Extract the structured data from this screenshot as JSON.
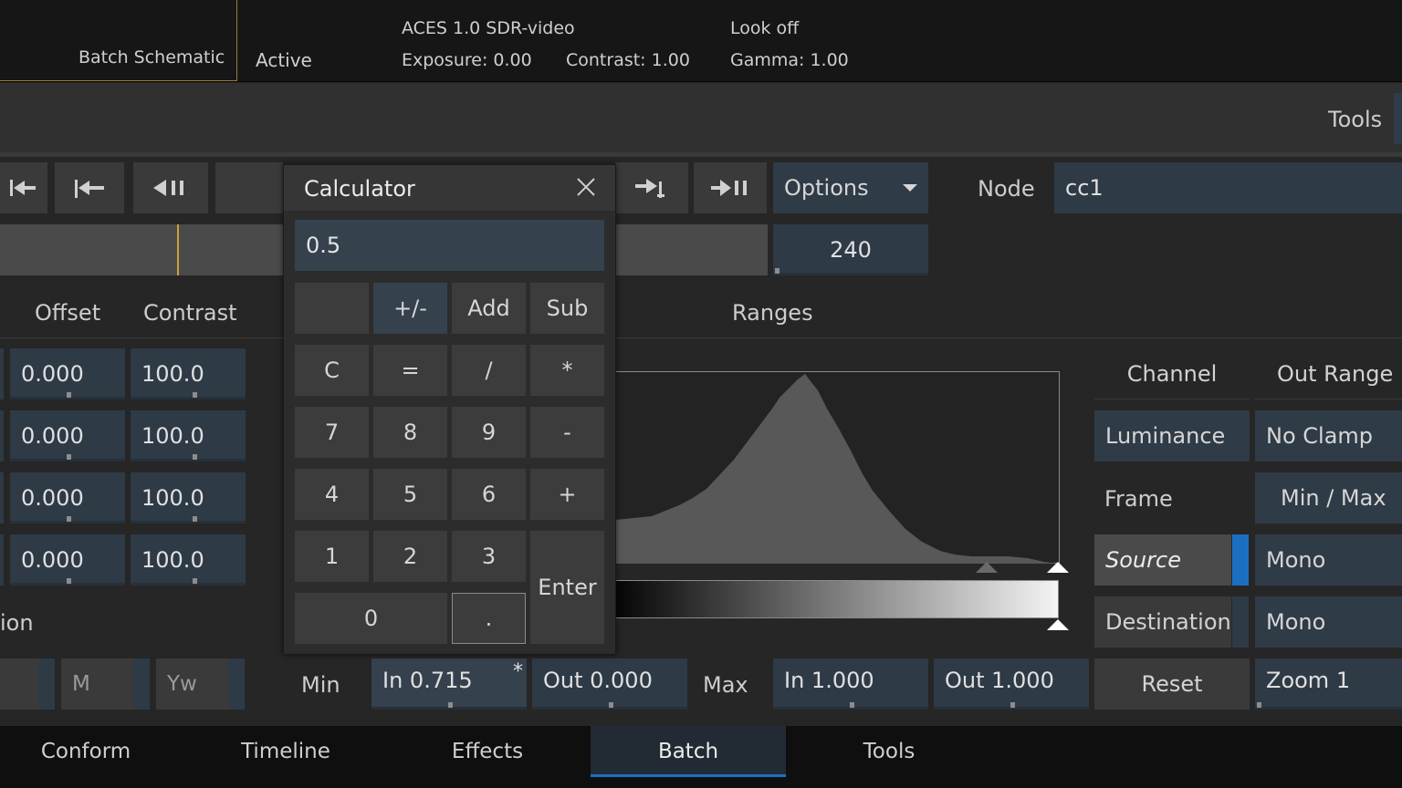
{
  "header": {
    "batch_tab": "Batch Schematic",
    "status": "Active",
    "colorspace": "ACES 1.0 SDR-video",
    "exposure": "Exposure: 0.00",
    "contrast": "Contrast: 1.00",
    "look": "Look off",
    "gamma": "Gamma: 1.00"
  },
  "toolbar": {
    "tools_label": "Tools"
  },
  "transport": {
    "options_label": "Options",
    "node_label": "Node",
    "node_value": "cc1",
    "frame_value": "240"
  },
  "grade": {
    "col_offset": "Offset",
    "col_contrast": "Contrast",
    "rows": [
      {
        "offset": "0.000",
        "contrast": "100.0"
      },
      {
        "offset": "0.000",
        "contrast": "100.0"
      },
      {
        "offset": "0.000",
        "contrast": "100.0"
      },
      {
        "offset": "0.000",
        "contrast": "100.0"
      }
    ],
    "section_partial": "ion",
    "m_label": "M",
    "yw_label": "Yw"
  },
  "ranges": {
    "title": "Ranges",
    "min_label": "Min",
    "min_in": "In 0.715",
    "min_in_mark": "*",
    "min_out": "Out 0.000",
    "max_label": "Max",
    "max_in": "In 1.000",
    "max_out": "Out 1.000"
  },
  "right_panel": {
    "channel_header": "Channel",
    "outrange_header": "Out Range",
    "luminance": "Luminance",
    "no_clamp": "No Clamp",
    "frame": "Frame",
    "min_max": "Min / Max",
    "source": "Source",
    "mono1": "Mono",
    "destination": "Destination",
    "mono2": "Mono",
    "reset": "Reset",
    "zoom": "Zoom 1"
  },
  "calculator": {
    "title": "Calculator",
    "display": "0.5",
    "keys": {
      "plusminus": "+/-",
      "add": "Add",
      "sub": "Sub",
      "c": "C",
      "eq": "=",
      "div": "/",
      "mul": "*",
      "k7": "7",
      "k8": "8",
      "k9": "9",
      "minus": "-",
      "k4": "4",
      "k5": "5",
      "k6": "6",
      "plus": "+",
      "k1": "1",
      "k2": "2",
      "k3": "3",
      "enter": "Enter",
      "k0": "0",
      "dot": "."
    }
  },
  "bottom_tabs": [
    "Conform",
    "Timeline",
    "Effects",
    "Batch",
    "Tools"
  ],
  "active_tab": "Batch",
  "colors": {
    "accent_blue": "#1b6fc2",
    "field_blue": "#2e3a46",
    "gold": "#9b7d3a"
  }
}
